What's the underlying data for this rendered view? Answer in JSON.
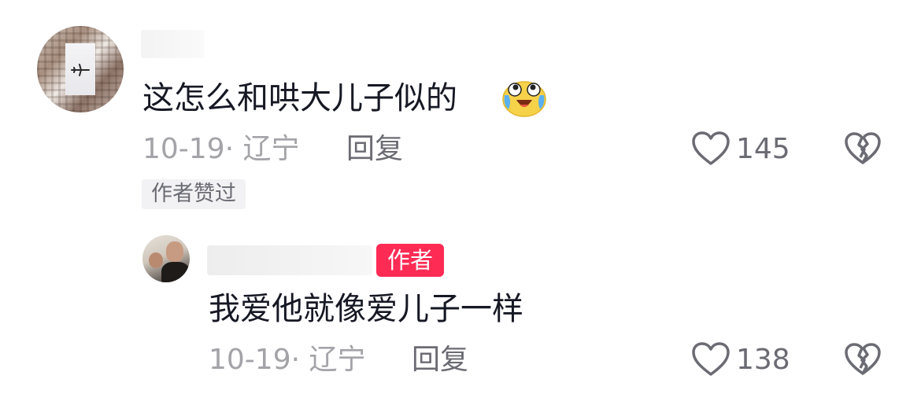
{
  "comments": [
    {
      "text": "这怎么和哄大儿子似的",
      "emoji": "crying-laughing-emoji",
      "date": "10-19",
      "separator": "·",
      "location": "辽宁",
      "reply_label": "回复",
      "likes": "145",
      "liked_by_author_label": "作者赞过",
      "replies": [
        {
          "author_tag": "作者",
          "text": "我爱他就像爱儿子一样",
          "date": "10-19",
          "separator": "·",
          "location": "辽宁",
          "reply_label": "回复",
          "likes": "138"
        }
      ]
    }
  ],
  "icons": {
    "like": "heart-outline-icon",
    "dislike": "broken-heart-icon"
  },
  "colors": {
    "author_tag_bg": "#fe2c55",
    "text_primary": "#161823",
    "text_secondary": "#a3a3a8",
    "text_action": "#6b6b73"
  }
}
